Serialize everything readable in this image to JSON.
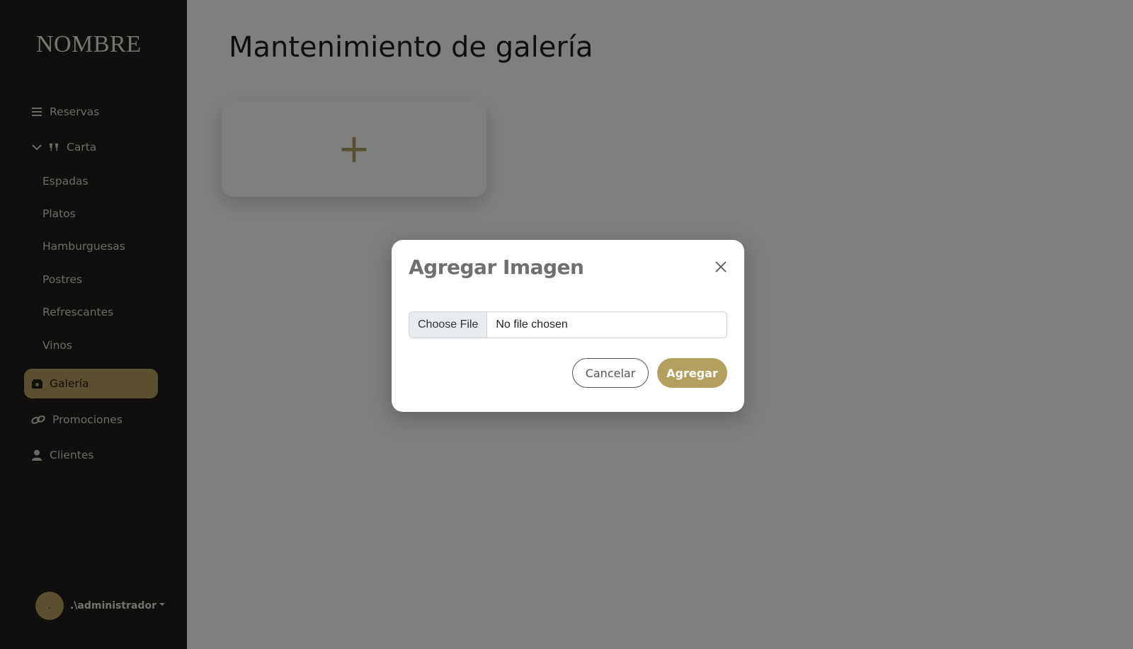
{
  "sidebar": {
    "brand": "NOMBRE",
    "items": [
      {
        "label": "Reservas",
        "icon": "list-icon"
      },
      {
        "label": "Carta",
        "icon": "dining-icon",
        "expanded": true
      },
      {
        "label": "Galería",
        "icon": "gallery-icon",
        "active": true
      },
      {
        "label": "Promociones",
        "icon": "link-icon"
      },
      {
        "label": "Clientes",
        "icon": "user-icon"
      }
    ],
    "carta_subitems": [
      "Espadas",
      "Platos",
      "Hamburguesas",
      "Postres",
      "Refrescantes",
      "Vinos"
    ],
    "user": {
      "avatar_text": ".",
      "name": ".\\administrador"
    }
  },
  "main": {
    "title": "Mantenimiento de galería",
    "add_card": {
      "icon": "plus-icon",
      "symbol": "+"
    }
  },
  "modal": {
    "title": "Agregar Imagen",
    "close_icon": "close-icon",
    "file_button_label": "Choose File",
    "file_status": "No file chosen",
    "cancel_label": "Cancelar",
    "submit_label": "Agregar"
  },
  "colors": {
    "accent": "#b59f5f",
    "sidebar_bg": "#231e1b",
    "overlay": "rgba(0,0,0,0.5)"
  }
}
